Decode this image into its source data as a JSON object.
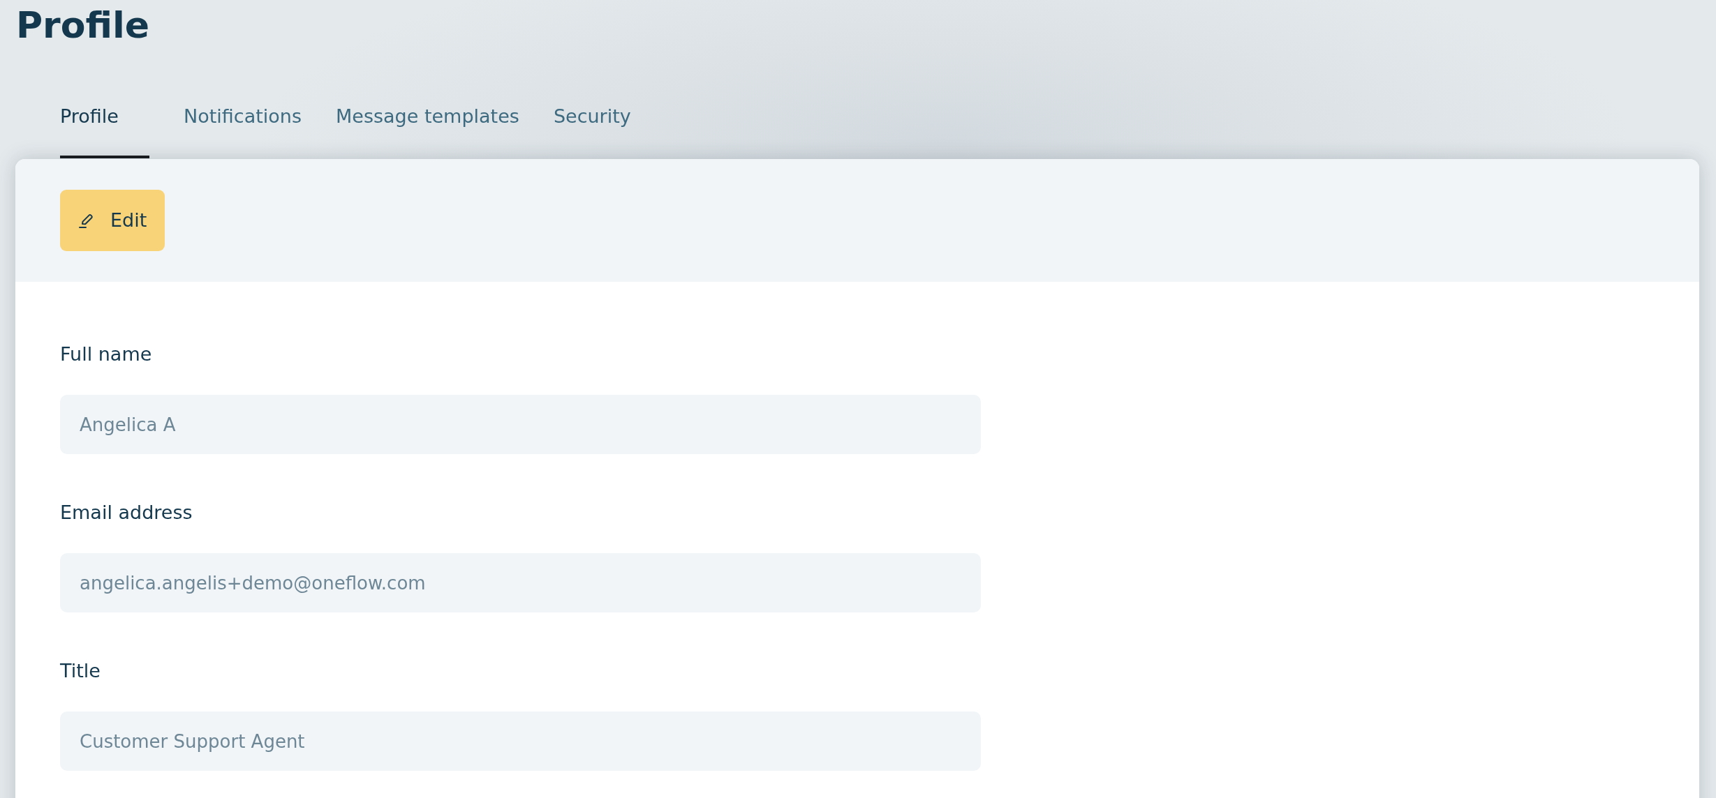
{
  "page": {
    "title": "Profile"
  },
  "tabs": [
    {
      "label": "Profile",
      "selected": true
    },
    {
      "label": "Notifications",
      "selected": false
    },
    {
      "label": "Message templates",
      "selected": false
    },
    {
      "label": "Security",
      "selected": false
    }
  ],
  "toolbar": {
    "edit_button": {
      "label": "Edit"
    }
  },
  "fields": [
    {
      "label": "Full name",
      "value": "Angelica A",
      "disabled": true
    },
    {
      "label": "Email address",
      "value": "angelica.angelis+demo@oneflow.com",
      "disabled": true
    },
    {
      "label": "Title",
      "value": "Customer Support Agent",
      "disabled": true
    }
  ]
}
